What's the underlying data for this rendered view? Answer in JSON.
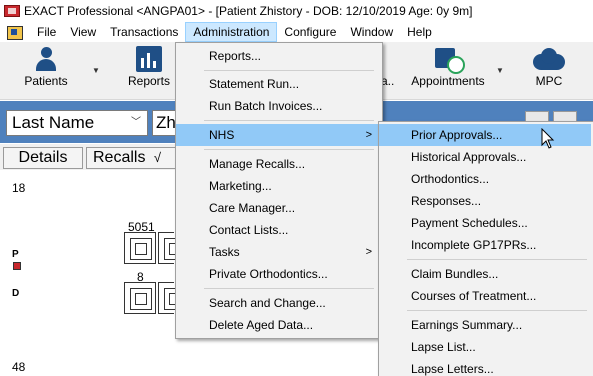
{
  "window": {
    "title": "EXACT Professional <ANGPA01> - [Patient Zhistory - DOB: 12/10/2019 Age: 0y 9m]"
  },
  "menubar": {
    "items": [
      "File",
      "View",
      "Transactions",
      "Administration",
      "Configure",
      "Window",
      "Help"
    ],
    "active": "Administration"
  },
  "toolbar": {
    "patients": "Patients",
    "reports": "Reports",
    "partial": "a...",
    "appointments": "Appointments",
    "mpc": "MPC"
  },
  "search": {
    "field_select": "Last Name",
    "query": "Zha"
  },
  "tabs": {
    "details": "Details",
    "recalls": "Recalls",
    "recalls_mark": "√"
  },
  "chart": {
    "label_18": "18",
    "label_5051": "5051",
    "label_8": "8",
    "label_48": "48",
    "p": "P",
    "d": "D"
  },
  "admin_menu": {
    "items": [
      "Reports...",
      "Statement Run...",
      "Run Batch Invoices...",
      "NHS",
      "Manage Recalls...",
      "Marketing...",
      "Care Manager...",
      "Contact Lists...",
      "Tasks",
      "Private Orthodontics...",
      "Search and Change...",
      "Delete Aged Data..."
    ],
    "submenu_arrow": ">"
  },
  "nhs_menu": {
    "items": [
      "Prior Approvals...",
      "Historical Approvals...",
      "Orthodontics...",
      "Responses...",
      "Payment Schedules...",
      "Incomplete GP17PRs...",
      "Claim Bundles...",
      "Courses of Treatment...",
      "Earnings Summary...",
      "Lapse List...",
      "Lapse Letters..."
    ]
  },
  "colors": {
    "accent_strip": "#4f81bd",
    "highlight": "#91c9f7",
    "menu_active": "#cce8ff"
  }
}
